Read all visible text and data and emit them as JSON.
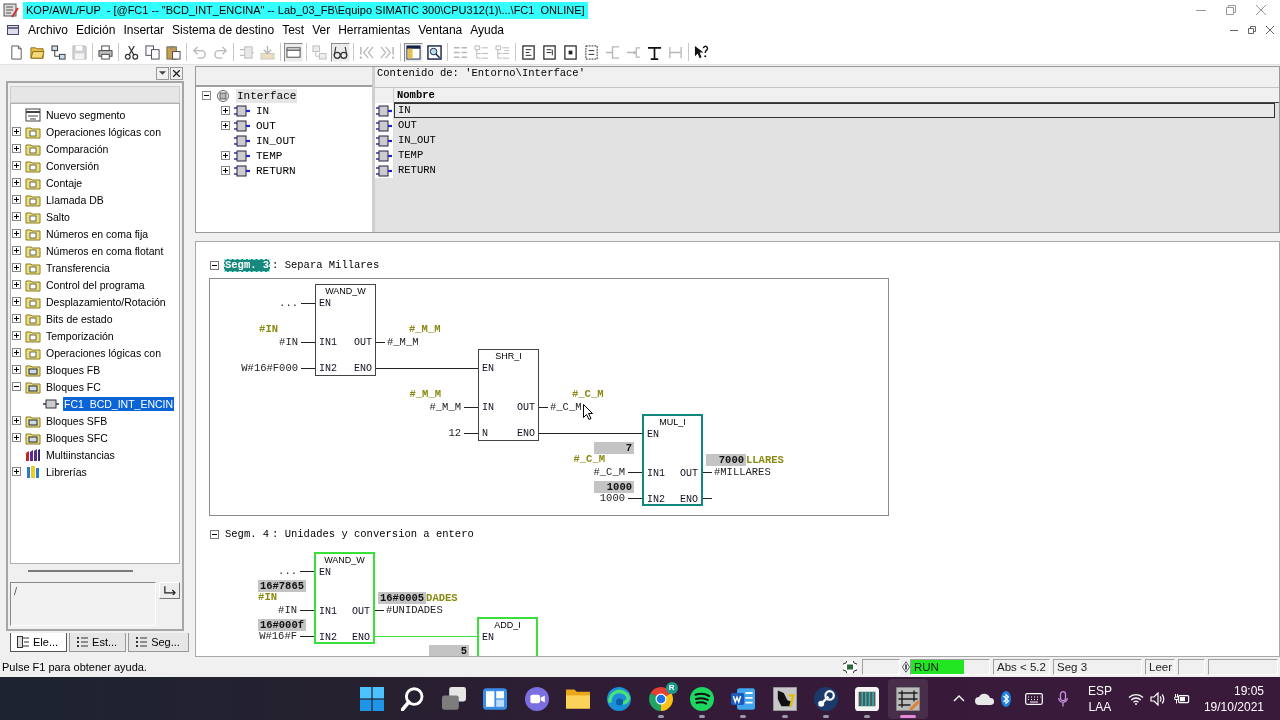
{
  "window": {
    "title": "KOP/AWL/FUP  - [@FC1 -- \"BCD_INT_ENCINA\" -- Lab_03_FB\\Equipo SIMATIC 300\\CPU312(1)\\...\\FC1  ONLINE]"
  },
  "menu": [
    "Archivo",
    "Edición",
    "Insertar",
    "Sistema de destino",
    "Test",
    "Ver",
    "Herramientas",
    "Ventana",
    "Ayuda"
  ],
  "toolbar": [
    {
      "disabled": false,
      "on": false
    },
    {
      "disabled": false,
      "on": false
    },
    {
      "disabled": false,
      "on": false
    },
    {
      "disabled": true,
      "on": false
    },
    {
      "disabled": false,
      "on": false
    },
    {
      "disabled": false,
      "on": false
    },
    {
      "disabled": false,
      "on": false
    },
    {
      "disabled": false,
      "on": false
    },
    {
      "disabled": true,
      "on": false
    },
    {
      "disabled": true,
      "on": false
    },
    {
      "disabled": true,
      "on": false
    },
    {
      "disabled": true,
      "on": false
    },
    {
      "disabled": false,
      "on": true
    },
    {
      "disabled": true,
      "on": false
    },
    {
      "disabled": false,
      "on": true
    },
    {
      "disabled": true,
      "on": false
    },
    {
      "disabled": true,
      "on": false
    },
    {
      "disabled": false,
      "on": true
    },
    {
      "disabled": false,
      "on": false
    },
    {
      "disabled": true,
      "on": false
    },
    {
      "disabled": true,
      "on": false
    },
    {
      "disabled": true,
      "on": false
    },
    {
      "disabled": false,
      "on": false
    },
    {
      "disabled": false,
      "on": false
    },
    {
      "disabled": false,
      "on": false
    },
    {
      "disabled": false,
      "on": false
    },
    {
      "disabled": true,
      "on": false
    },
    {
      "disabled": true,
      "on": false
    },
    {
      "disabled": false,
      "on": false
    },
    {
      "disabled": true,
      "on": false
    },
    {
      "disabled": false,
      "on": false
    }
  ],
  "catalog": {
    "items": [
      {
        "label": "Nuevo segmento",
        "kind": "network",
        "selected": false
      },
      {
        "label": "Operaciones lógicas con",
        "kind": "folder",
        "expanded": false,
        "selected": false
      },
      {
        "label": "Comparación",
        "kind": "folder",
        "expanded": false,
        "selected": false
      },
      {
        "label": "Conversión",
        "kind": "folder",
        "expanded": false,
        "selected": false
      },
      {
        "label": "Contaje",
        "kind": "folder",
        "expanded": false,
        "selected": false
      },
      {
        "label": "Llamada DB",
        "kind": "folder",
        "expanded": false,
        "selected": false
      },
      {
        "label": "Salto",
        "kind": "folder",
        "expanded": false,
        "selected": false
      },
      {
        "label": "Números en coma fija",
        "kind": "folder",
        "expanded": false,
        "selected": false
      },
      {
        "label": "Números en coma flotant",
        "kind": "folder",
        "expanded": false,
        "selected": false
      },
      {
        "label": "Transferencia",
        "kind": "folder",
        "expanded": false,
        "selected": false
      },
      {
        "label": "Control del programa",
        "kind": "folder",
        "expanded": false,
        "selected": false
      },
      {
        "label": "Desplazamiento/Rotación",
        "kind": "folder",
        "expanded": false,
        "selected": false
      },
      {
        "label": "Bits de estado",
        "kind": "folder",
        "expanded": false,
        "selected": false
      },
      {
        "label": "Temporización",
        "kind": "folder",
        "expanded": false,
        "selected": false
      },
      {
        "label": "Operaciones lógicas con",
        "kind": "folder",
        "expanded": false,
        "selected": false
      },
      {
        "label": "Bloques FB",
        "kind": "blocks",
        "expanded": false,
        "selected": false
      },
      {
        "label": "Bloques FC",
        "kind": "blocks",
        "expanded": true,
        "selected": false,
        "children": [
          {
            "label": "FC1  BCD_INT_ENCIN",
            "kind": "block",
            "selected": true
          }
        ]
      },
      {
        "label": "Bloques SFB",
        "kind": "blocks",
        "expanded": false,
        "selected": false
      },
      {
        "label": "Bloques SFC",
        "kind": "blocks",
        "expanded": false,
        "selected": false
      },
      {
        "label": "Multiinstancias",
        "kind": "multiinstance",
        "selected": false
      },
      {
        "label": "Librerías",
        "kind": "library",
        "expanded": false,
        "selected": false
      }
    ],
    "path": "/",
    "tabs": [
      {
        "label": "Ele...",
        "selected": true
      },
      {
        "label": "Est...",
        "selected": false
      },
      {
        "label": "Seg...",
        "selected": false
      }
    ]
  },
  "interface": {
    "tree": [
      {
        "label": "Interface",
        "expanded": true,
        "selected": true,
        "children": [
          {
            "label": "IN",
            "expanded": false,
            "selected": false
          },
          {
            "label": "OUT",
            "expanded": false,
            "selected": false
          },
          {
            "label": "IN_OUT",
            "selected": false
          },
          {
            "label": "TEMP",
            "expanded": false,
            "selected": false
          },
          {
            "label": "RETURN",
            "expanded": false,
            "selected": false
          }
        ]
      }
    ],
    "heading": "Contenido de: 'Entorno\\Interface'",
    "columns": [
      "Nombre"
    ],
    "rows": [
      {
        "name": "IN",
        "selected": true
      },
      {
        "name": "OUT",
        "selected": false
      },
      {
        "name": "IN_OUT",
        "selected": false
      },
      {
        "name": "TEMP",
        "selected": false
      },
      {
        "name": "RETURN",
        "selected": false
      }
    ]
  },
  "networks": [
    {
      "label": "Segm. 3",
      "title": ": Separa Millares",
      "selected": true,
      "blocks": [
        {
          "name": "WAND_W",
          "selected": false,
          "powered": false,
          "inputs": [
            {
              "pin": "EN",
              "operand": "..."
            },
            {
              "pin": "IN1",
              "operand": "#IN",
              "symbol": "#IN"
            },
            {
              "pin": "IN2",
              "operand": "W#16#F000"
            }
          ],
          "outputs": [
            {
              "pin": "OUT",
              "operand": "#_M_M",
              "symbol": "#_M_M"
            },
            {
              "pin": "ENO"
            }
          ]
        },
        {
          "name": "SHR_I",
          "selected": false,
          "powered": false,
          "inputs": [
            {
              "pin": "EN"
            },
            {
              "pin": "IN",
              "operand": "#_M_M",
              "symbol": "#_M_M"
            },
            {
              "pin": "N",
              "operand": "12"
            }
          ],
          "outputs": [
            {
              "pin": "OUT",
              "operand": "#_C_M",
              "symbol": "#_C_M"
            },
            {
              "pin": "ENO"
            }
          ]
        },
        {
          "name": "MUL_I",
          "selected": true,
          "powered": false,
          "inputs": [
            {
              "pin": "EN"
            },
            {
              "pin": "IN1",
              "operand": "#_C_M",
              "symbol": "#_C_M",
              "value": "7"
            },
            {
              "pin": "IN2",
              "operand": "1000",
              "value": "1000"
            }
          ],
          "outputs": [
            {
              "pin": "OUT",
              "operand": "#MILLARES",
              "symbol": "LLARES",
              "value": "7000"
            },
            {
              "pin": "ENO"
            }
          ]
        }
      ]
    },
    {
      "label": "Segm. 4",
      "title": ": Unidades y conversion a entero",
      "selected": false,
      "blocks": [
        {
          "name": "WAND_W",
          "selected": false,
          "powered": true,
          "inputs": [
            {
              "pin": "EN",
              "operand": "..."
            },
            {
              "pin": "IN1",
              "operand": "#IN",
              "symbol": "#IN",
              "value": "16#7865"
            },
            {
              "pin": "IN2",
              "operand": "W#16#F",
              "value": "16#000f"
            }
          ],
          "outputs": [
            {
              "pin": "OUT",
              "operand": "#UNIDADES",
              "symbol": "DADES",
              "value": "16#0005"
            },
            {
              "pin": "ENO"
            }
          ]
        },
        {
          "name": "ADD_I",
          "selected": false,
          "powered": true,
          "inputs": [
            {
              "pin": "EN"
            },
            {
              "value": "5"
            }
          ]
        }
      ]
    }
  ],
  "status_bar": {
    "message": "Pulse F1 para obtener ayuda.",
    "cpu_mode": {
      "text": "RUN",
      "on": true
    },
    "fields": [
      "Abs < 5.2",
      "Seg 3",
      "Leer"
    ]
  },
  "taskbar": {
    "apps": [
      {
        "running": false,
        "selected": false
      },
      {
        "running": false,
        "selected": false
      },
      {
        "running": false,
        "selected": false
      },
      {
        "running": false,
        "selected": false
      },
      {
        "running": false,
        "selected": false
      },
      {
        "running": false,
        "selected": false
      },
      {
        "running": false,
        "selected": false
      },
      {
        "running": true,
        "selected": false,
        "badge": "R"
      },
      {
        "running": true,
        "selected": false
      },
      {
        "running": true,
        "selected": false
      },
      {
        "running": true,
        "selected": false
      },
      {
        "running": true,
        "selected": false
      },
      {
        "running": true,
        "selected": false
      },
      {
        "running": true,
        "selected": true
      }
    ],
    "tray": {
      "language": [
        "ESP",
        "LAA"
      ],
      "time": "19:05",
      "date": "19/10/2021"
    }
  }
}
